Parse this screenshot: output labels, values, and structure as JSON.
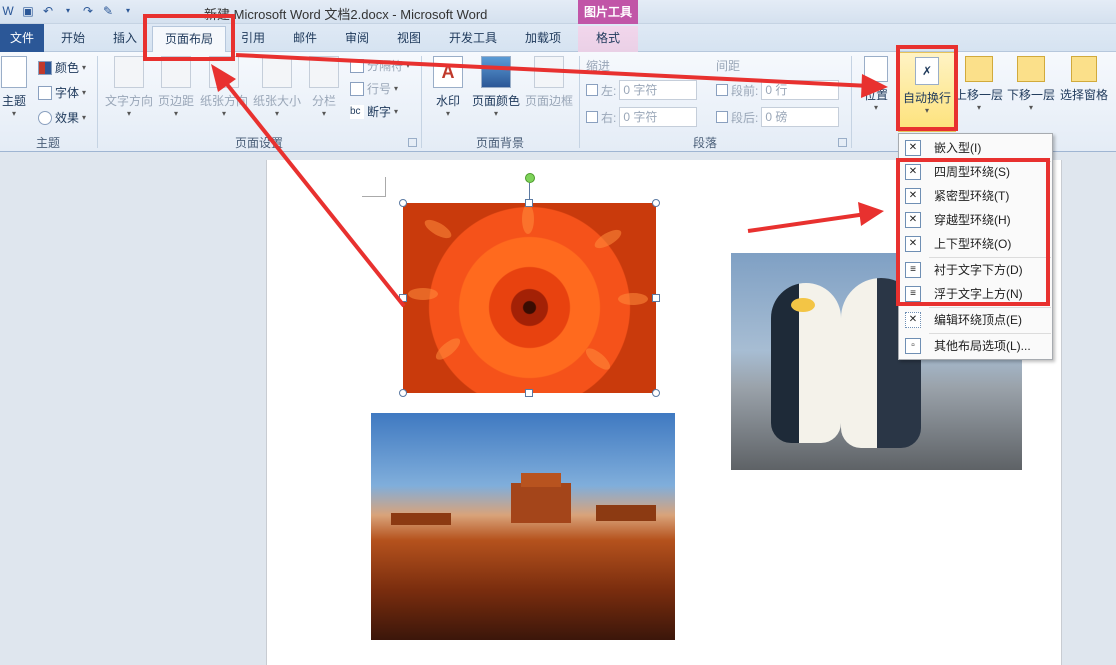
{
  "window": {
    "title": "新建 Microsoft Word 文档2.docx  -  Microsoft Word",
    "context_tab_group": "图片工具"
  },
  "tabs": [
    {
      "label": "文件"
    },
    {
      "label": "开始"
    },
    {
      "label": "插入"
    },
    {
      "label": "页面布局"
    },
    {
      "label": "引用"
    },
    {
      "label": "邮件"
    },
    {
      "label": "审阅"
    },
    {
      "label": "视图"
    },
    {
      "label": "开发工具"
    },
    {
      "label": "加载项"
    },
    {
      "label": "格式"
    }
  ],
  "ribbon": {
    "theme_group": {
      "label": "主题",
      "theme_button": "主题",
      "colors": "颜色",
      "fonts": "字体",
      "effects": "效果"
    },
    "page_setup_group": {
      "label": "页面设置",
      "text_direction": "文字方向",
      "margins": "页边距",
      "orientation": "纸张方向",
      "size": "纸张大小",
      "columns": "分栏",
      "breaks": "分隔符",
      "line_numbers": "行号",
      "hyphenation": "断字"
    },
    "page_background_group": {
      "label": "页面背景",
      "watermark": "水印",
      "page_color": "页面颜色",
      "page_borders": "页面边框"
    },
    "paragraph_group": {
      "label": "段落",
      "indent": "缩进",
      "spacing": "间距",
      "left": "左:",
      "right": "右:",
      "before": "段前:",
      "after": "段后:",
      "left_value": "0 字符",
      "right_value": "0 字符",
      "before_value": "0 行",
      "after_value": "0 磅"
    },
    "arrange_group": {
      "position": "位置",
      "wrap_text": "自动换行",
      "bring_forward": "上移一层",
      "send_backward": "下移一层",
      "selection_pane": "选择窗格"
    }
  },
  "wrap_menu": {
    "items": [
      {
        "label": "嵌入型(I)",
        "icon": "inline-wrap-icon"
      },
      {
        "label": "四周型环绕(S)",
        "icon": "square-wrap-icon"
      },
      {
        "label": "紧密型环绕(T)",
        "icon": "tight-wrap-icon"
      },
      {
        "label": "穿越型环绕(H)",
        "icon": "through-wrap-icon"
      },
      {
        "label": "上下型环绕(O)",
        "icon": "top-bottom-wrap-icon"
      },
      {
        "label": "衬于文字下方(D)",
        "icon": "behind-text-icon"
      },
      {
        "label": "浮于文字上方(N)",
        "icon": "in-front-text-icon"
      },
      {
        "label": "编辑环绕顶点(E)",
        "icon": "edit-wrap-points-icon"
      },
      {
        "label": "其他布局选项(L)...",
        "icon": "more-layout-options-icon"
      }
    ]
  },
  "colors": {
    "annotation_red": "#e8312f",
    "file_tab_blue": "#2b5797",
    "picture_tools_pink": "#c155a7",
    "selected_button_yellow": "#fde27a"
  }
}
